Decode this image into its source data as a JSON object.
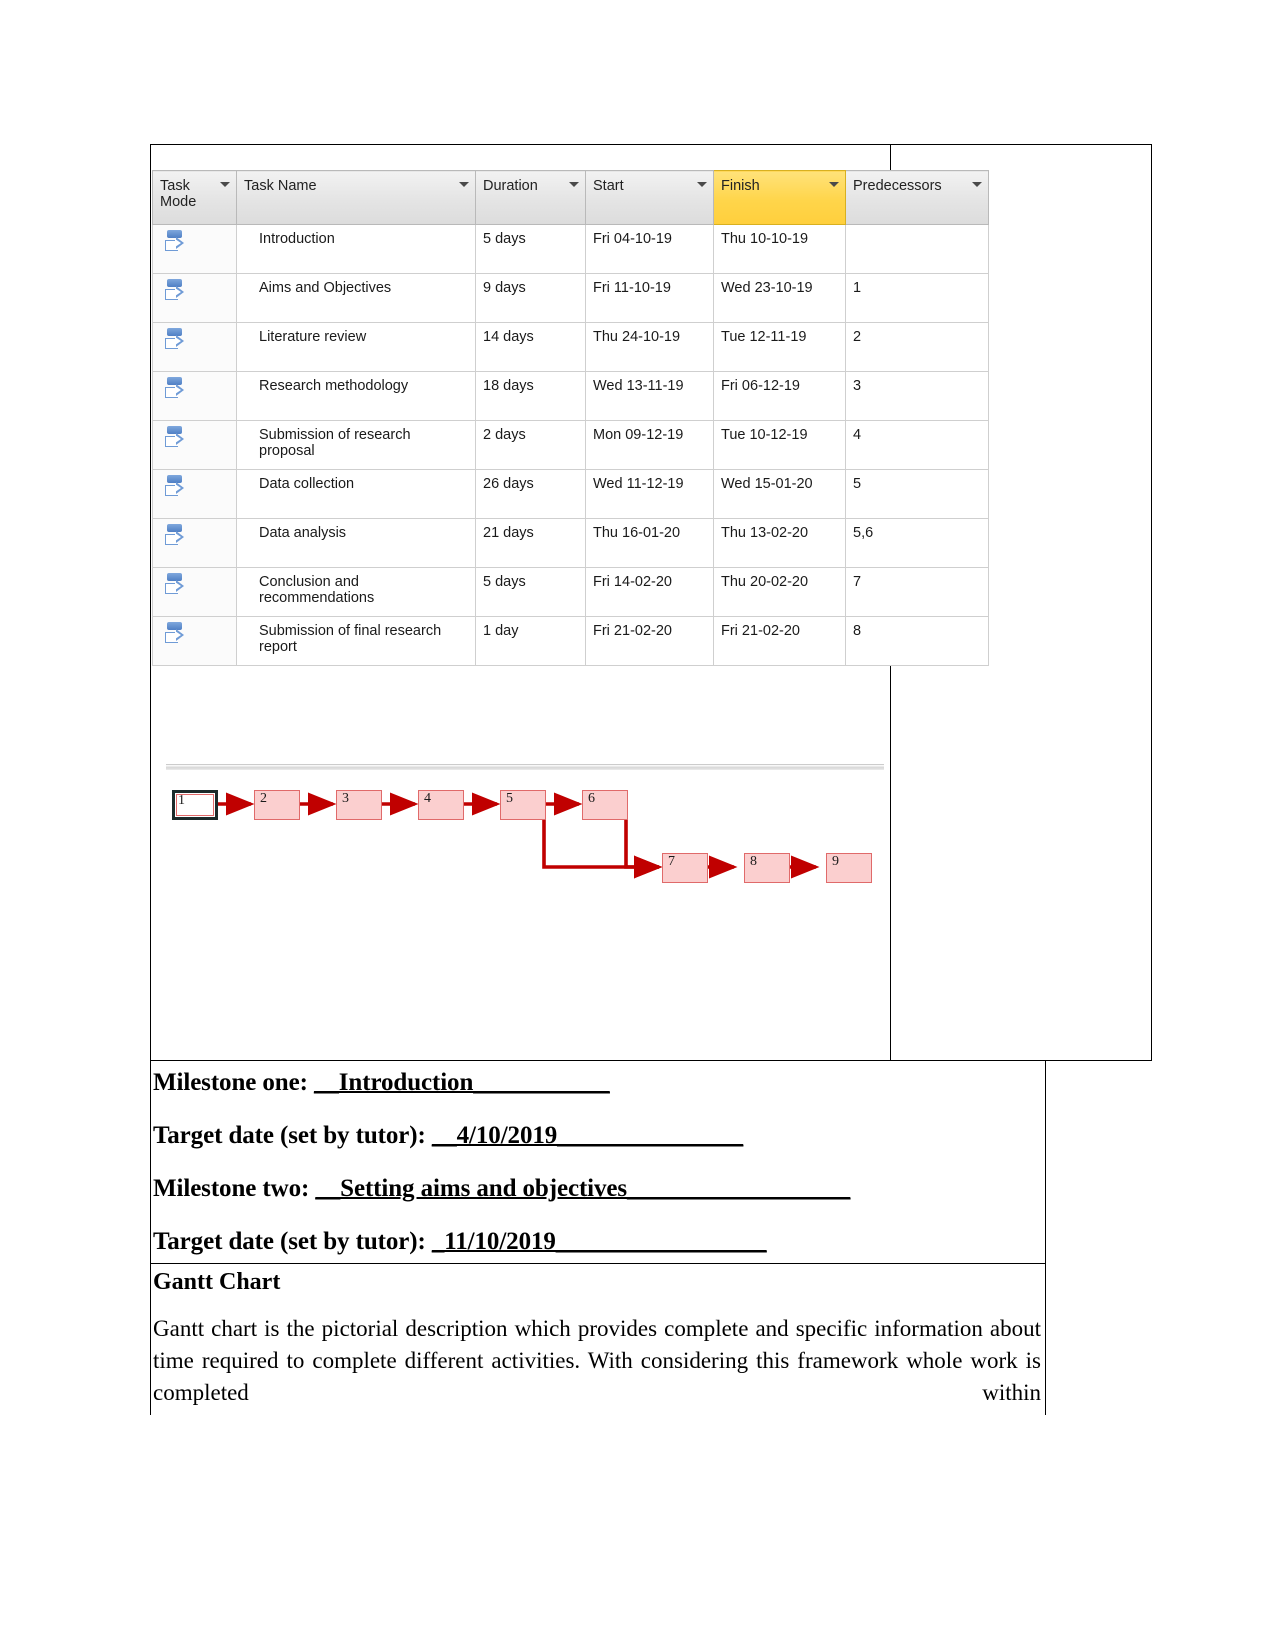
{
  "document": {
    "table": {
      "columns": [
        {
          "key": "task_mode",
          "label": "Task Mode",
          "has_filter": true,
          "highlighted": false
        },
        {
          "key": "task_name",
          "label": "Task Name",
          "has_filter": true,
          "highlighted": false
        },
        {
          "key": "duration",
          "label": "Duration",
          "has_filter": true,
          "highlighted": false
        },
        {
          "key": "start",
          "label": "Start",
          "has_filter": true,
          "highlighted": false
        },
        {
          "key": "finish",
          "label": "Finish",
          "has_filter": true,
          "highlighted": true
        },
        {
          "key": "predecessors",
          "label": "Predecessors",
          "has_filter": true,
          "highlighted": false
        }
      ],
      "highlight_color": "#ffd54a",
      "rows": [
        {
          "mode_icon": "auto-schedule-icon",
          "task_name": "Introduction",
          "duration": "5 days",
          "start": "Fri 04-10-19",
          "finish": "Thu 10-10-19",
          "predecessors": ""
        },
        {
          "mode_icon": "auto-schedule-icon",
          "task_name": "Aims and Objectives",
          "duration": "9 days",
          "start": "Fri 11-10-19",
          "finish": "Wed 23-10-19",
          "predecessors": "1"
        },
        {
          "mode_icon": "auto-schedule-icon",
          "task_name": "Literature review",
          "duration": "14 days",
          "start": "Thu 24-10-19",
          "finish": "Tue 12-11-19",
          "predecessors": "2"
        },
        {
          "mode_icon": "auto-schedule-icon",
          "task_name": "Research methodology",
          "duration": "18 days",
          "start": "Wed 13-11-19",
          "finish": "Fri 06-12-19",
          "predecessors": "3"
        },
        {
          "mode_icon": "auto-schedule-icon",
          "task_name": "Submission of research proposal",
          "duration": "2 days",
          "start": "Mon 09-12-19",
          "finish": "Tue 10-12-19",
          "predecessors": "4"
        },
        {
          "mode_icon": "auto-schedule-icon",
          "task_name": "Data collection",
          "duration": "26 days",
          "start": "Wed 11-12-19",
          "finish": "Wed 15-01-20",
          "predecessors": "5"
        },
        {
          "mode_icon": "auto-schedule-icon",
          "task_name": "Data analysis",
          "duration": "21 days",
          "start": "Thu 16-01-20",
          "finish": "Thu 13-02-20",
          "predecessors": "5,6"
        },
        {
          "mode_icon": "auto-schedule-icon",
          "task_name": "Conclusion and recommendations",
          "duration": "5 days",
          "start": "Fri 14-02-20",
          "finish": "Thu 20-02-20",
          "predecessors": "7"
        },
        {
          "mode_icon": "auto-schedule-icon",
          "task_name": "Submission of final research report",
          "duration": "1 day",
          "start": "Fri 21-02-20",
          "finish": "Fri 21-02-20",
          "predecessors": "8"
        }
      ]
    },
    "network_diagram": {
      "node_fill": "#fbcfcf",
      "node_border": "#e06a6a",
      "connector_color": "#c00000",
      "selected_node": "1",
      "nodes": [
        {
          "id": "1",
          "label": "1",
          "row": "top"
        },
        {
          "id": "2",
          "label": "2",
          "row": "top"
        },
        {
          "id": "3",
          "label": "3",
          "row": "top"
        },
        {
          "id": "4",
          "label": "4",
          "row": "top"
        },
        {
          "id": "5",
          "label": "5",
          "row": "top"
        },
        {
          "id": "6",
          "label": "6",
          "row": "top"
        },
        {
          "id": "7",
          "label": "7",
          "row": "bottom"
        },
        {
          "id": "8",
          "label": "8",
          "row": "bottom"
        },
        {
          "id": "9",
          "label": "9",
          "row": "bottom"
        }
      ],
      "links": [
        {
          "from": "1",
          "to": "2"
        },
        {
          "from": "2",
          "to": "3"
        },
        {
          "from": "3",
          "to": "4"
        },
        {
          "from": "4",
          "to": "5"
        },
        {
          "from": "5",
          "to": "6"
        },
        {
          "from": "5",
          "to": "7"
        },
        {
          "from": "6",
          "to": "7"
        },
        {
          "from": "7",
          "to": "8"
        },
        {
          "from": "8",
          "to": "9"
        }
      ]
    },
    "milestones": [
      {
        "label": "Milestone one:",
        "value": "__Introduction___________"
      },
      {
        "label": "Target date (set by tutor):",
        "value": "__4/10/2019_______________"
      },
      {
        "label": "Milestone two:",
        "value": "__Setting aims and objectives__________________"
      },
      {
        "label": "Target date (set by tutor):",
        "value": "_11/10/2019_________________"
      }
    ],
    "gantt_section": {
      "heading": "Gantt Chart",
      "paragraph": "Gantt chart is the pictorial description which provides complete and specific information about time required to complete different activities. With considering this framework whole work is completed within"
    }
  }
}
